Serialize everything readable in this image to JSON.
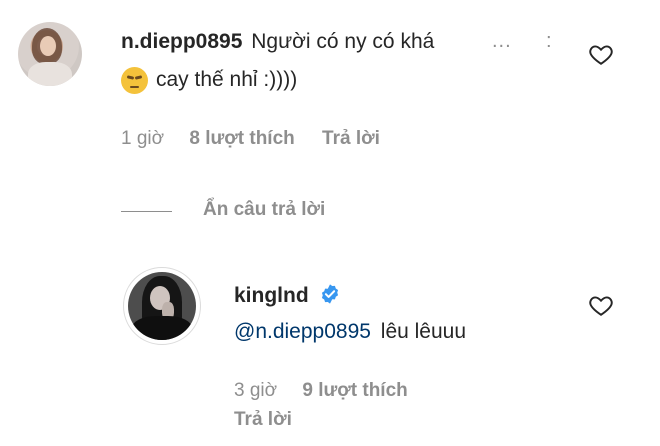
{
  "comment": {
    "username": "n.diepp0895",
    "text_line1": "Người có ny có khá",
    "text_line2": "cay thế nhỉ :))))",
    "emoji": "unamused-face",
    "time": "1 giờ",
    "likes": "8 lượt thích",
    "reply_label": "Trả lời",
    "more_label": "...",
    "hide_replies_label": "Ẩn câu trả lời"
  },
  "reply": {
    "username": "kinglnd",
    "verified": true,
    "mention": "@n.diepp0895",
    "text": "lêu lêuuu",
    "time": "3 giờ",
    "likes": "9 lượt thích",
    "reply_label": "Trả lời"
  },
  "colors": {
    "text": "#262626",
    "secondary": "#8e8e8e",
    "mention": "#00376b",
    "verified": "#3897f0"
  }
}
